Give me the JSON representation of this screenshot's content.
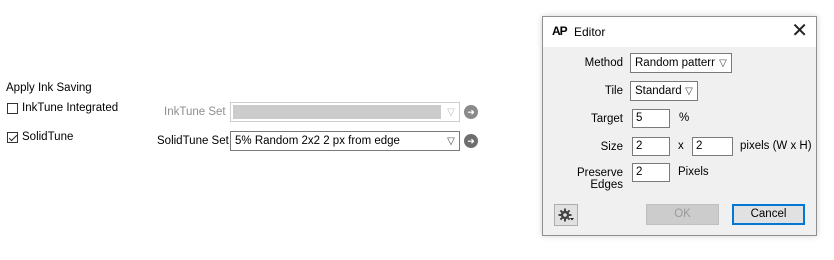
{
  "ink_saving": {
    "group_label": "Apply Ink Saving",
    "inktune": {
      "checkbox_label": "InkTune Integrated",
      "checked": false,
      "set_label": "InkTune Set",
      "set_value": ""
    },
    "solidtune": {
      "checkbox_label": "SolidTune",
      "checked": true,
      "set_label": "SolidTune Set",
      "set_value": "5% Random 2x2 2 px from edge"
    }
  },
  "editor": {
    "app_icon_text": "AP",
    "title": "Editor",
    "close_glyph": "✕",
    "method": {
      "label": "Method",
      "value": "Random pattern"
    },
    "tile": {
      "label": "Tile",
      "value": "Standard"
    },
    "target": {
      "label": "Target",
      "value": "5",
      "unit": "%"
    },
    "size": {
      "label": "Size",
      "width": "2",
      "separator": "x",
      "height": "2",
      "unit": "pixels (W x H)"
    },
    "preserve_edges": {
      "label": "Preserve Edges",
      "value": "2",
      "unit": "Pixels"
    },
    "ok_label": "OK",
    "cancel_label": "Cancel",
    "settings_icon": "gear-icon"
  },
  "colors": {
    "dialog_bg": "#f0f0f0",
    "primary_border": "#0078d7",
    "disabled_fill": "#cccccc"
  }
}
